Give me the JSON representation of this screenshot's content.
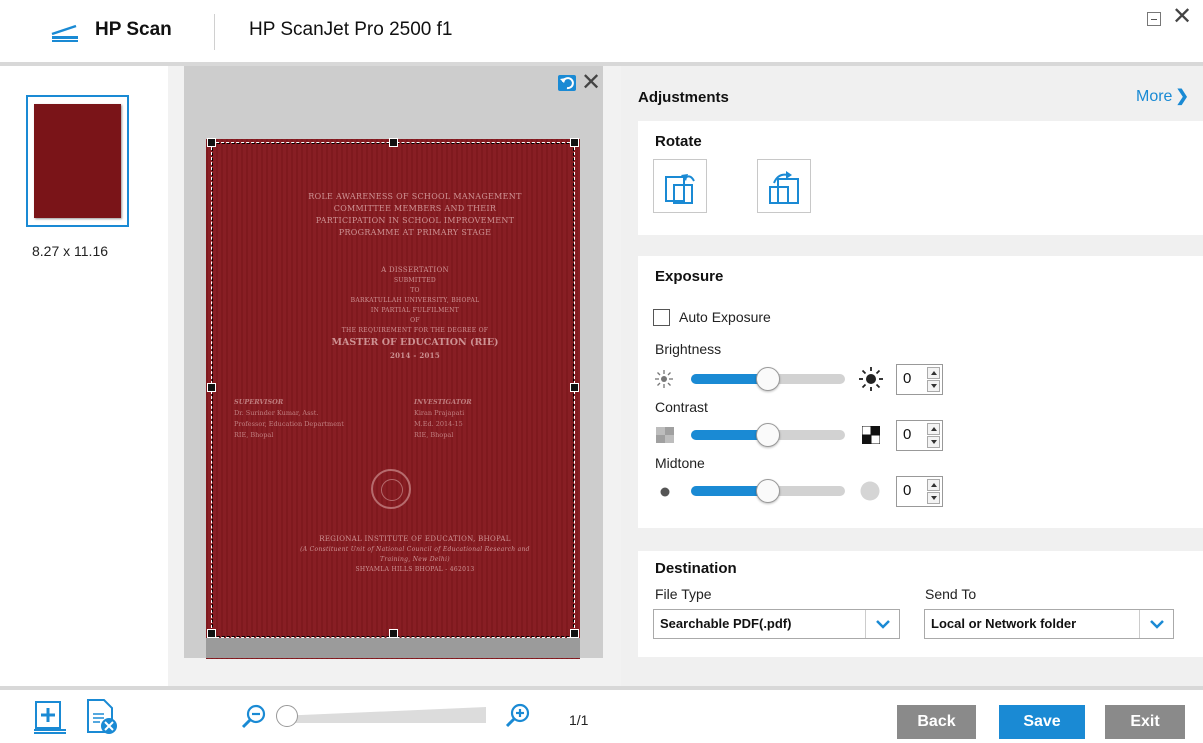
{
  "titlebar": {
    "app_name": "HP Scan",
    "device_name": "HP ScanJet Pro 2500 f1",
    "icons": [
      "scanner-icon",
      "minimize-icon",
      "close-icon"
    ]
  },
  "thumbnail": {
    "size_label": "8.27 x 11.16"
  },
  "preview": {
    "document": {
      "title_lines": [
        "ROLE AWARENESS OF SCHOOL MANAGEMENT",
        "COMMITTEE MEMBERS AND THEIR",
        "PARTICIPATION IN SCHOOL IMPROVEMENT",
        "PROGRAMME AT PRIMARY STAGE"
      ],
      "body_lines": [
        "A DISSERTATION",
        "SUBMITTED",
        "TO",
        "BARKATULLAH UNIVERSITY, BHOPAL",
        "IN PARTIAL FULFILMENT",
        "OF",
        "THE REQUIREMENT FOR THE DEGREE OF"
      ],
      "degree": "MASTER OF EDUCATION (RIE)",
      "year": "2014 - 2015",
      "supervisor_head": "SUPERVISOR",
      "supervisor_lines": [
        "Dr. Surinder Kumar, Asst.",
        "Professor, Education Department",
        "RIE, Bhopal"
      ],
      "investigator_head": "INVESTIGATOR",
      "investigator_lines": [
        "Kiran Prajapati",
        "M.Ed. 2014-15",
        "RIE, Bhopal"
      ],
      "footer_lines": [
        "REGIONAL INSTITUTE OF EDUCATION, BHOPAL",
        "(A Constituent Unit of National Council of Educational Research and",
        "Training, New Delhi)",
        "SHYAMLA HILLS BHOPAL - 462013"
      ]
    }
  },
  "adjustments": {
    "title": "Adjustments",
    "more_label": "More",
    "rotate": {
      "title": "Rotate"
    },
    "exposure": {
      "title": "Exposure",
      "auto_label": "Auto Exposure",
      "auto_checked": false,
      "brightness": {
        "label": "Brightness",
        "value": "0",
        "level": 0.5
      },
      "contrast": {
        "label": "Contrast",
        "value": "0",
        "level": 0.5
      },
      "midtone": {
        "label": "Midtone",
        "value": "0",
        "level": 0.5
      }
    },
    "destination": {
      "title": "Destination",
      "file_type_label": "File Type",
      "file_type_value": "Searchable PDF(.pdf)",
      "send_to_label": "Send To",
      "send_to_value": "Local or Network folder"
    }
  },
  "bottom": {
    "page_count": "1/1",
    "zoom_level": 0.0,
    "back_label": "Back",
    "save_label": "Save",
    "exit_label": "Exit"
  },
  "colors": {
    "accent": "#1a8ad4",
    "document_red": "#861a20",
    "button_gray": "#8a8a8a"
  }
}
